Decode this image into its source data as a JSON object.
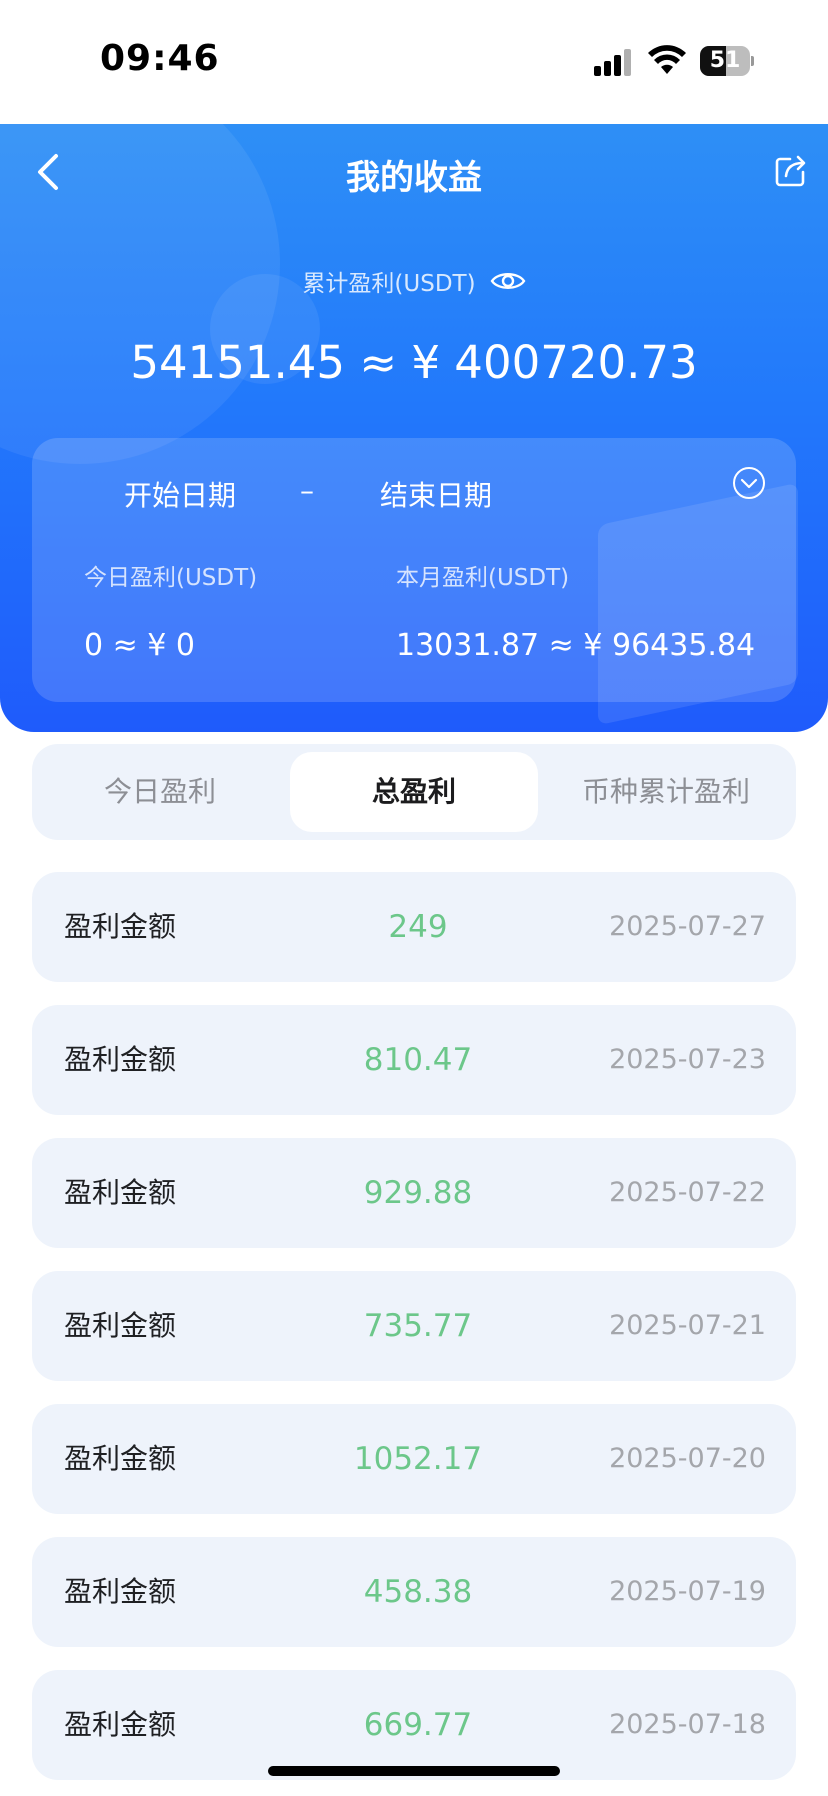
{
  "status_bar": {
    "time": "09:46",
    "battery_level": "51"
  },
  "header": {
    "title": "我的收益",
    "total_label": "累计盈利(USDT)",
    "total_value": "54151.45 ≈ ¥ 400720.73"
  },
  "date_filter": {
    "start_label": "开始日期",
    "separator": "–",
    "end_label": "结束日期"
  },
  "summary": {
    "today_label": "今日盈利(USDT)",
    "today_value": "0 ≈ ¥ 0",
    "month_label": "本月盈利(USDT)",
    "month_value": "13031.87 ≈ ¥ 96435.84"
  },
  "tabs": [
    {
      "label": "今日盈利",
      "active": false
    },
    {
      "label": "总盈利",
      "active": true
    },
    {
      "label": "币种累计盈利",
      "active": false
    }
  ],
  "records": [
    {
      "label": "盈利金额",
      "amount": "249",
      "date": "2025-07-27"
    },
    {
      "label": "盈利金额",
      "amount": "810.47",
      "date": "2025-07-23"
    },
    {
      "label": "盈利金额",
      "amount": "929.88",
      "date": "2025-07-22"
    },
    {
      "label": "盈利金额",
      "amount": "735.77",
      "date": "2025-07-21"
    },
    {
      "label": "盈利金额",
      "amount": "1052.17",
      "date": "2025-07-20"
    },
    {
      "label": "盈利金额",
      "amount": "458.38",
      "date": "2025-07-19"
    },
    {
      "label": "盈利金额",
      "amount": "669.77",
      "date": "2025-07-18"
    }
  ],
  "colors": {
    "header_top": "#2e8ff6",
    "header_bottom": "#1f5bfb",
    "amount_green": "#6cc78a",
    "card_bg": "#eef3fb"
  },
  "icons": {
    "back": "chevron-left-icon",
    "share": "share-icon",
    "eye": "eye-icon",
    "dropdown": "chevron-down-circle-icon"
  }
}
